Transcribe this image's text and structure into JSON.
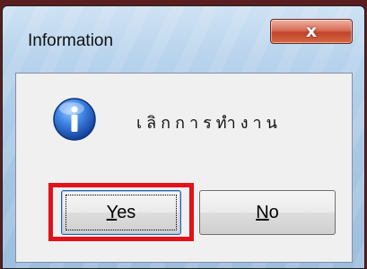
{
  "dialog": {
    "title": "Information",
    "close_label": "x",
    "message": "เลิกการทำงาน",
    "icon": "info-icon",
    "buttons": {
      "yes": {
        "mnemonic": "Y",
        "rest": "es"
      },
      "no": {
        "mnemonic": "N",
        "rest": "o"
      }
    }
  },
  "colors": {
    "highlight": "#e0121a",
    "close_button": "#c2442b",
    "icon_blue": "#1f5fc4"
  }
}
